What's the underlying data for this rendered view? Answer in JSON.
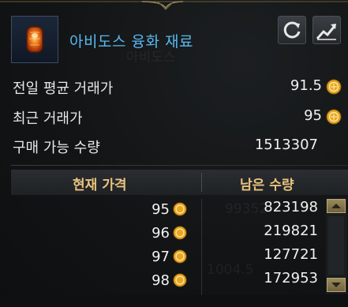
{
  "item": {
    "name": "아비도스 융화 재료",
    "icon": "fusion-material-icon"
  },
  "buttons": {
    "refresh_icon": "refresh-icon",
    "chart_icon": "trend-chart-icon"
  },
  "stats": {
    "avg_price_label": "전일 평균 거래가",
    "avg_price_value": "91.5",
    "recent_price_label": "최근 거래가",
    "recent_price_value": "95",
    "buyable_label": "구매 가능 수량",
    "buyable_value": "1513307"
  },
  "table": {
    "col_price": "현재 가격",
    "col_qty": "남은 수량",
    "rows": [
      {
        "price": "95",
        "qty": "823198"
      },
      {
        "price": "96",
        "qty": "219821"
      },
      {
        "price": "97",
        "qty": "127721"
      },
      {
        "price": "98",
        "qty": "172953"
      }
    ]
  },
  "colors": {
    "title": "#58b8f0",
    "header_text": "#e9c27c",
    "coin": "#e8a623"
  }
}
